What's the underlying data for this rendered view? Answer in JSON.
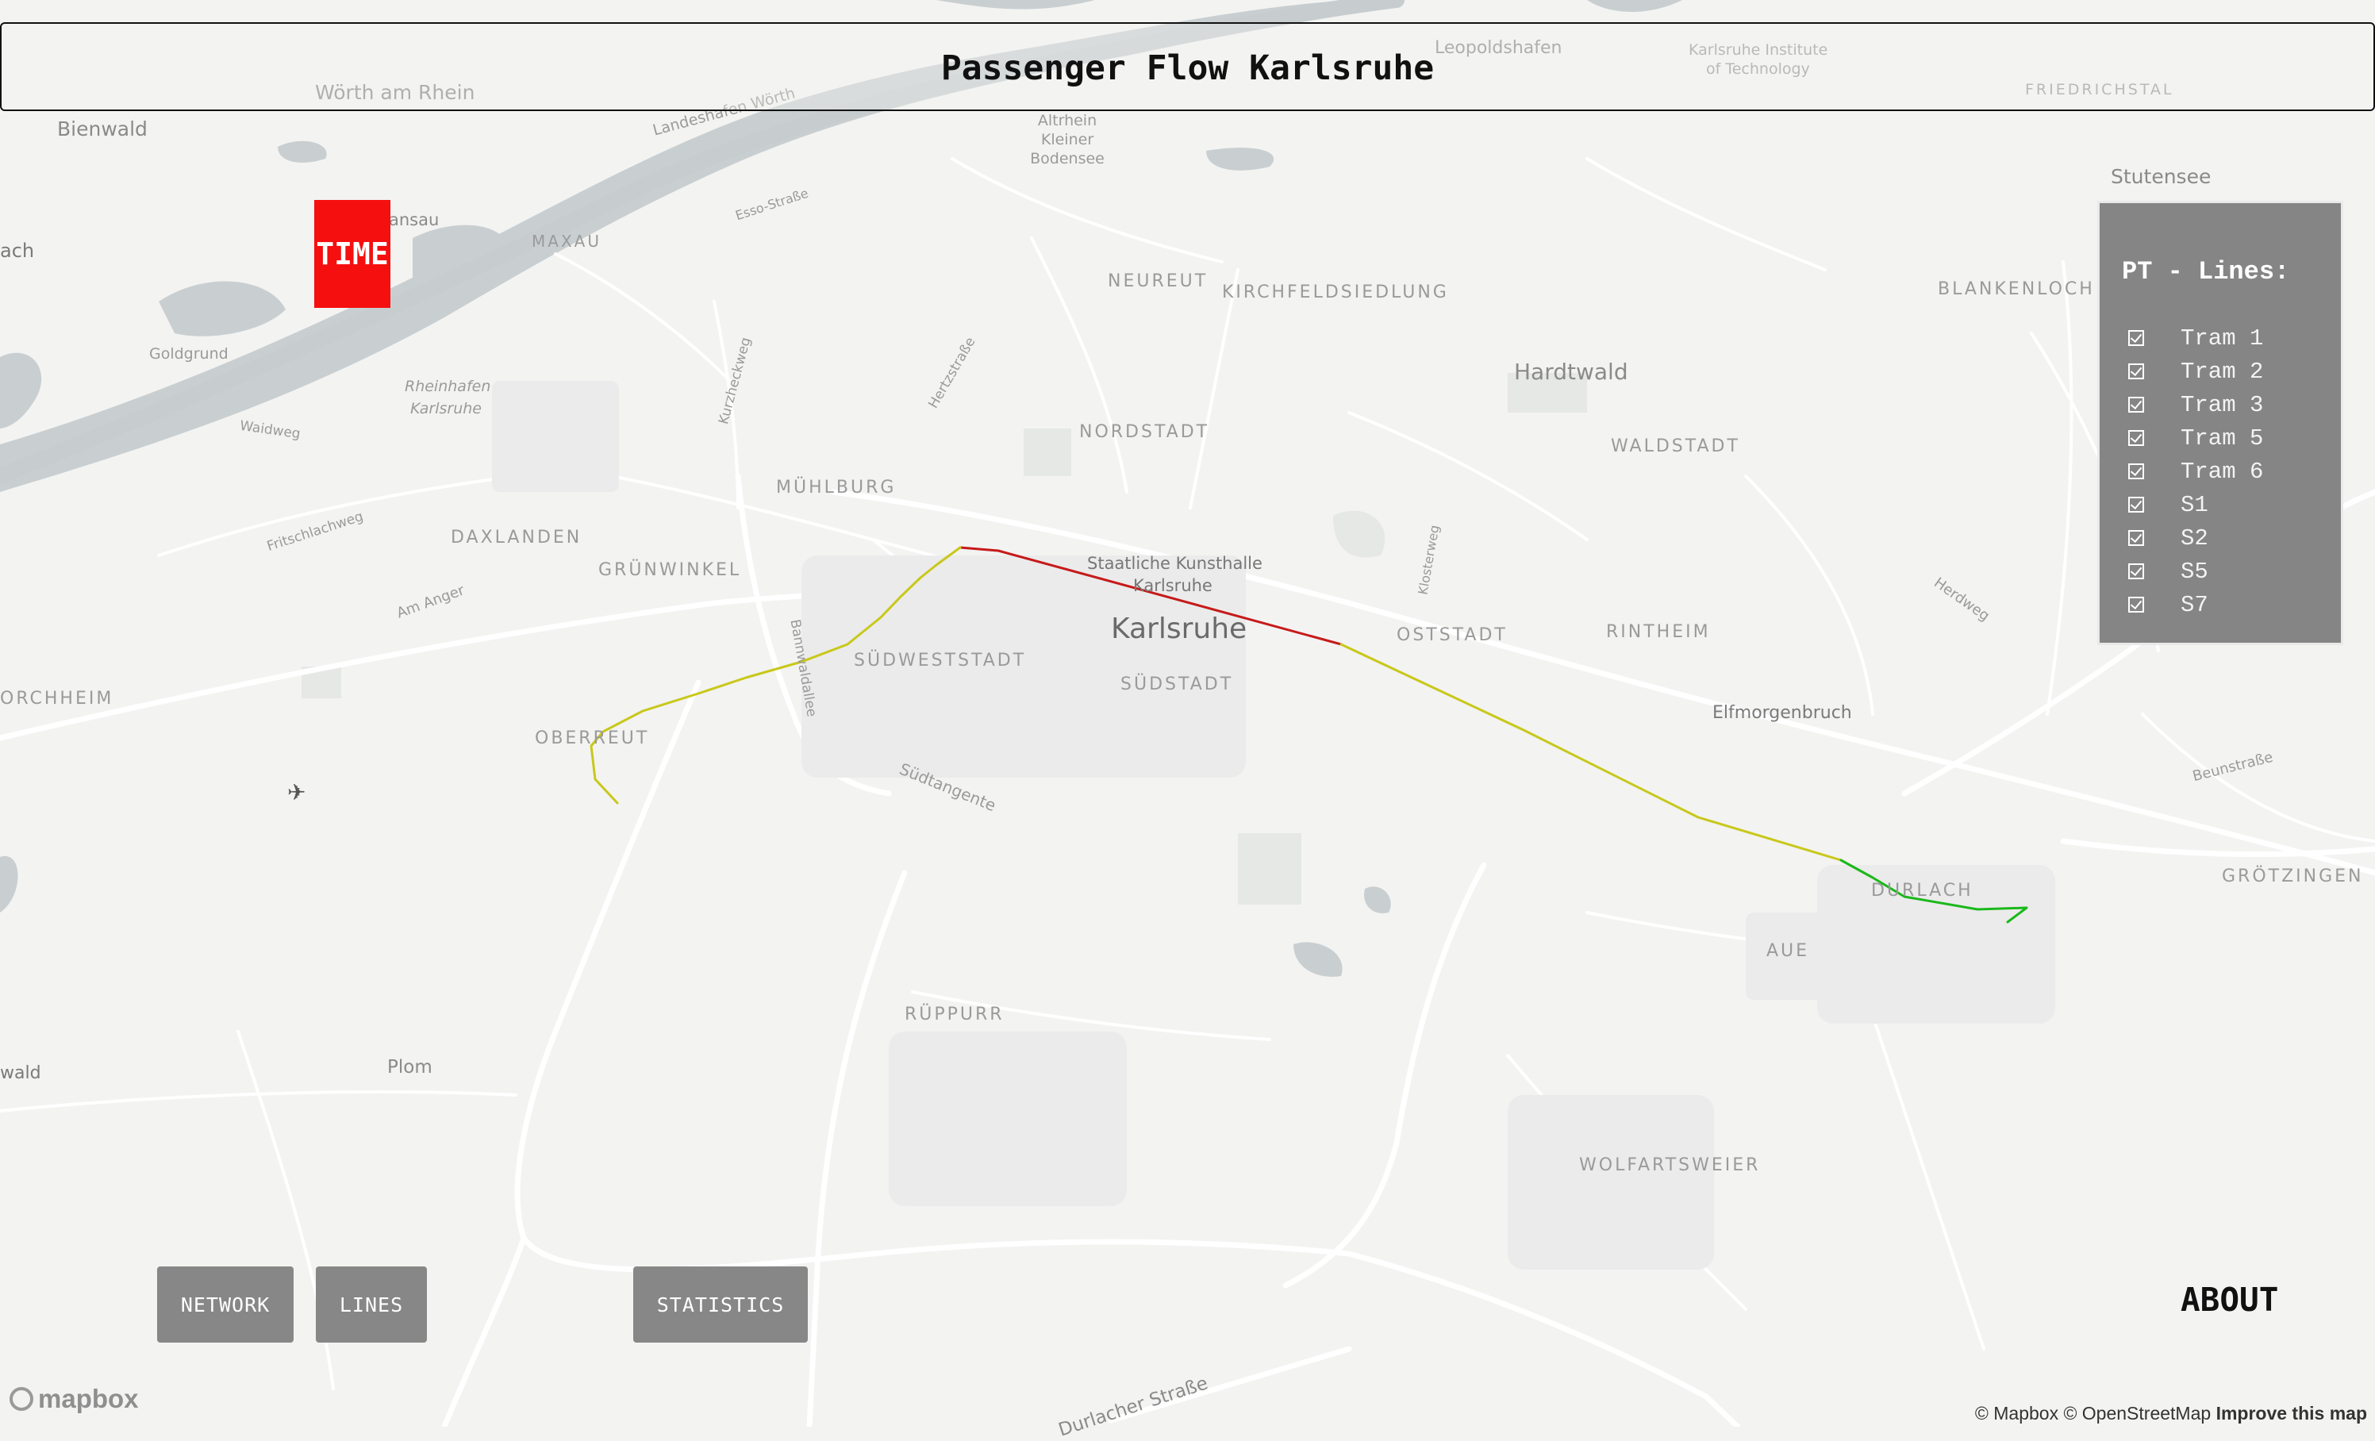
{
  "app": {
    "title": "Passenger Flow Karlsruhe"
  },
  "time_button": {
    "label": "TIME",
    "color": "#f50f0f"
  },
  "legend": {
    "title": "PT - Lines:",
    "items": [
      {
        "label": "Tram 1",
        "checked": true
      },
      {
        "label": "Tram 2",
        "checked": true
      },
      {
        "label": "Tram 3",
        "checked": true
      },
      {
        "label": "Tram 5",
        "checked": true
      },
      {
        "label": "Tram 6",
        "checked": true
      },
      {
        "label": "S1",
        "checked": true
      },
      {
        "label": "S2",
        "checked": true
      },
      {
        "label": "S5",
        "checked": true
      },
      {
        "label": "S7",
        "checked": true
      }
    ]
  },
  "buttons": {
    "network": "NETWORK",
    "lines": "LINES",
    "statistics": "STATISTICS",
    "about": "ABOUT"
  },
  "map": {
    "labels": [
      "Bienwald",
      "Wörth am Rhein",
      "Landeshafen Wörth",
      "Altrhein Kleiner Bodensee",
      "Leopoldshafen",
      "Karlsruhe Institute",
      "of Technology",
      "FRIEDRICHSTAL",
      "Stutensee",
      "MAXAU",
      "Esso-Straße",
      "NEUREUT",
      "KIRCHFELDSIEDLUNG",
      "BLANKENLOCH",
      "Goldgrund",
      "Rheinhafen",
      "Karlsruhe",
      "Waidweg",
      "Kurzheckweg",
      "Hertzstraße",
      "Hardtwald",
      "NORDSTADT",
      "WALDSTADT",
      "MÜHLBURG",
      "Fritschlachweg",
      "DAXLANDEN",
      "GRÜNWINKEL",
      "Staatliche Kunsthalle",
      "Karlsruhe",
      "Klosterweg",
      "Karlsruhe",
      "OSTSTADT",
      "RINTHEIM",
      "Herdweg",
      "Am Anger",
      "SÜDWESTSTADT",
      "Bannwaldallee",
      "SÜDSTADT",
      "Elfmorgenbruch",
      "ORCHHEIM",
      "OBERREUT",
      "Südtangente",
      "Beunstraße",
      "DURLACH",
      "GRÖTZINGEN",
      "AUE",
      "RÜPPURR",
      "Plom",
      "wald",
      "WOLFARTSWEIER",
      "Durlacher Straße",
      "ach",
      "ansau"
    ],
    "route_colors": [
      "#c61a1a",
      "#c8c81a",
      "#1ab81a"
    ]
  },
  "mapbox": {
    "logo": "mapbox",
    "attribution_prefix": "© Mapbox © OpenStreetMap",
    "improve": "Improve this map"
  }
}
